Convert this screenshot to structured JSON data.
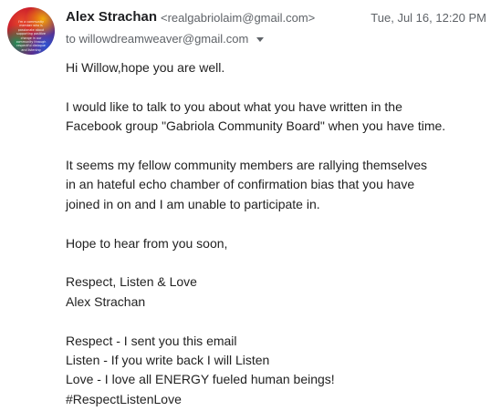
{
  "sender": {
    "name": "Alex Strachan",
    "email": "<realgabriolaim@gmail.com>",
    "avatar_text": "I'm a community member who is passionate about supporting positive change in our community through respectful dialogue and listening"
  },
  "date": "Tue, Jul 16, 12:20 PM",
  "recipient": "to willowdreamweaver@gmail.com",
  "body": {
    "greeting": "Hi Willow,hope you are well.",
    "para1": [
      "I would like to talk to you about what you have written in the",
      "Facebook group \"Gabriola Community Board\" when you have time."
    ],
    "para2": [
      "It seems my fellow community members are rallying themselves",
      "in an hateful echo chamber of confirmation bias that you have",
      "joined in on and I am unable to participate in."
    ],
    "para3": "Hope to hear from you soon,",
    "signoff": [
      "Respect, Listen & Love",
      "Alex Strachan"
    ],
    "postscript": [
      "Respect - I sent you this email",
      "Listen - If you write back I will Listen",
      "Love - I love all ENERGY fueled human beings!",
      "#RespectListenLove"
    ]
  }
}
